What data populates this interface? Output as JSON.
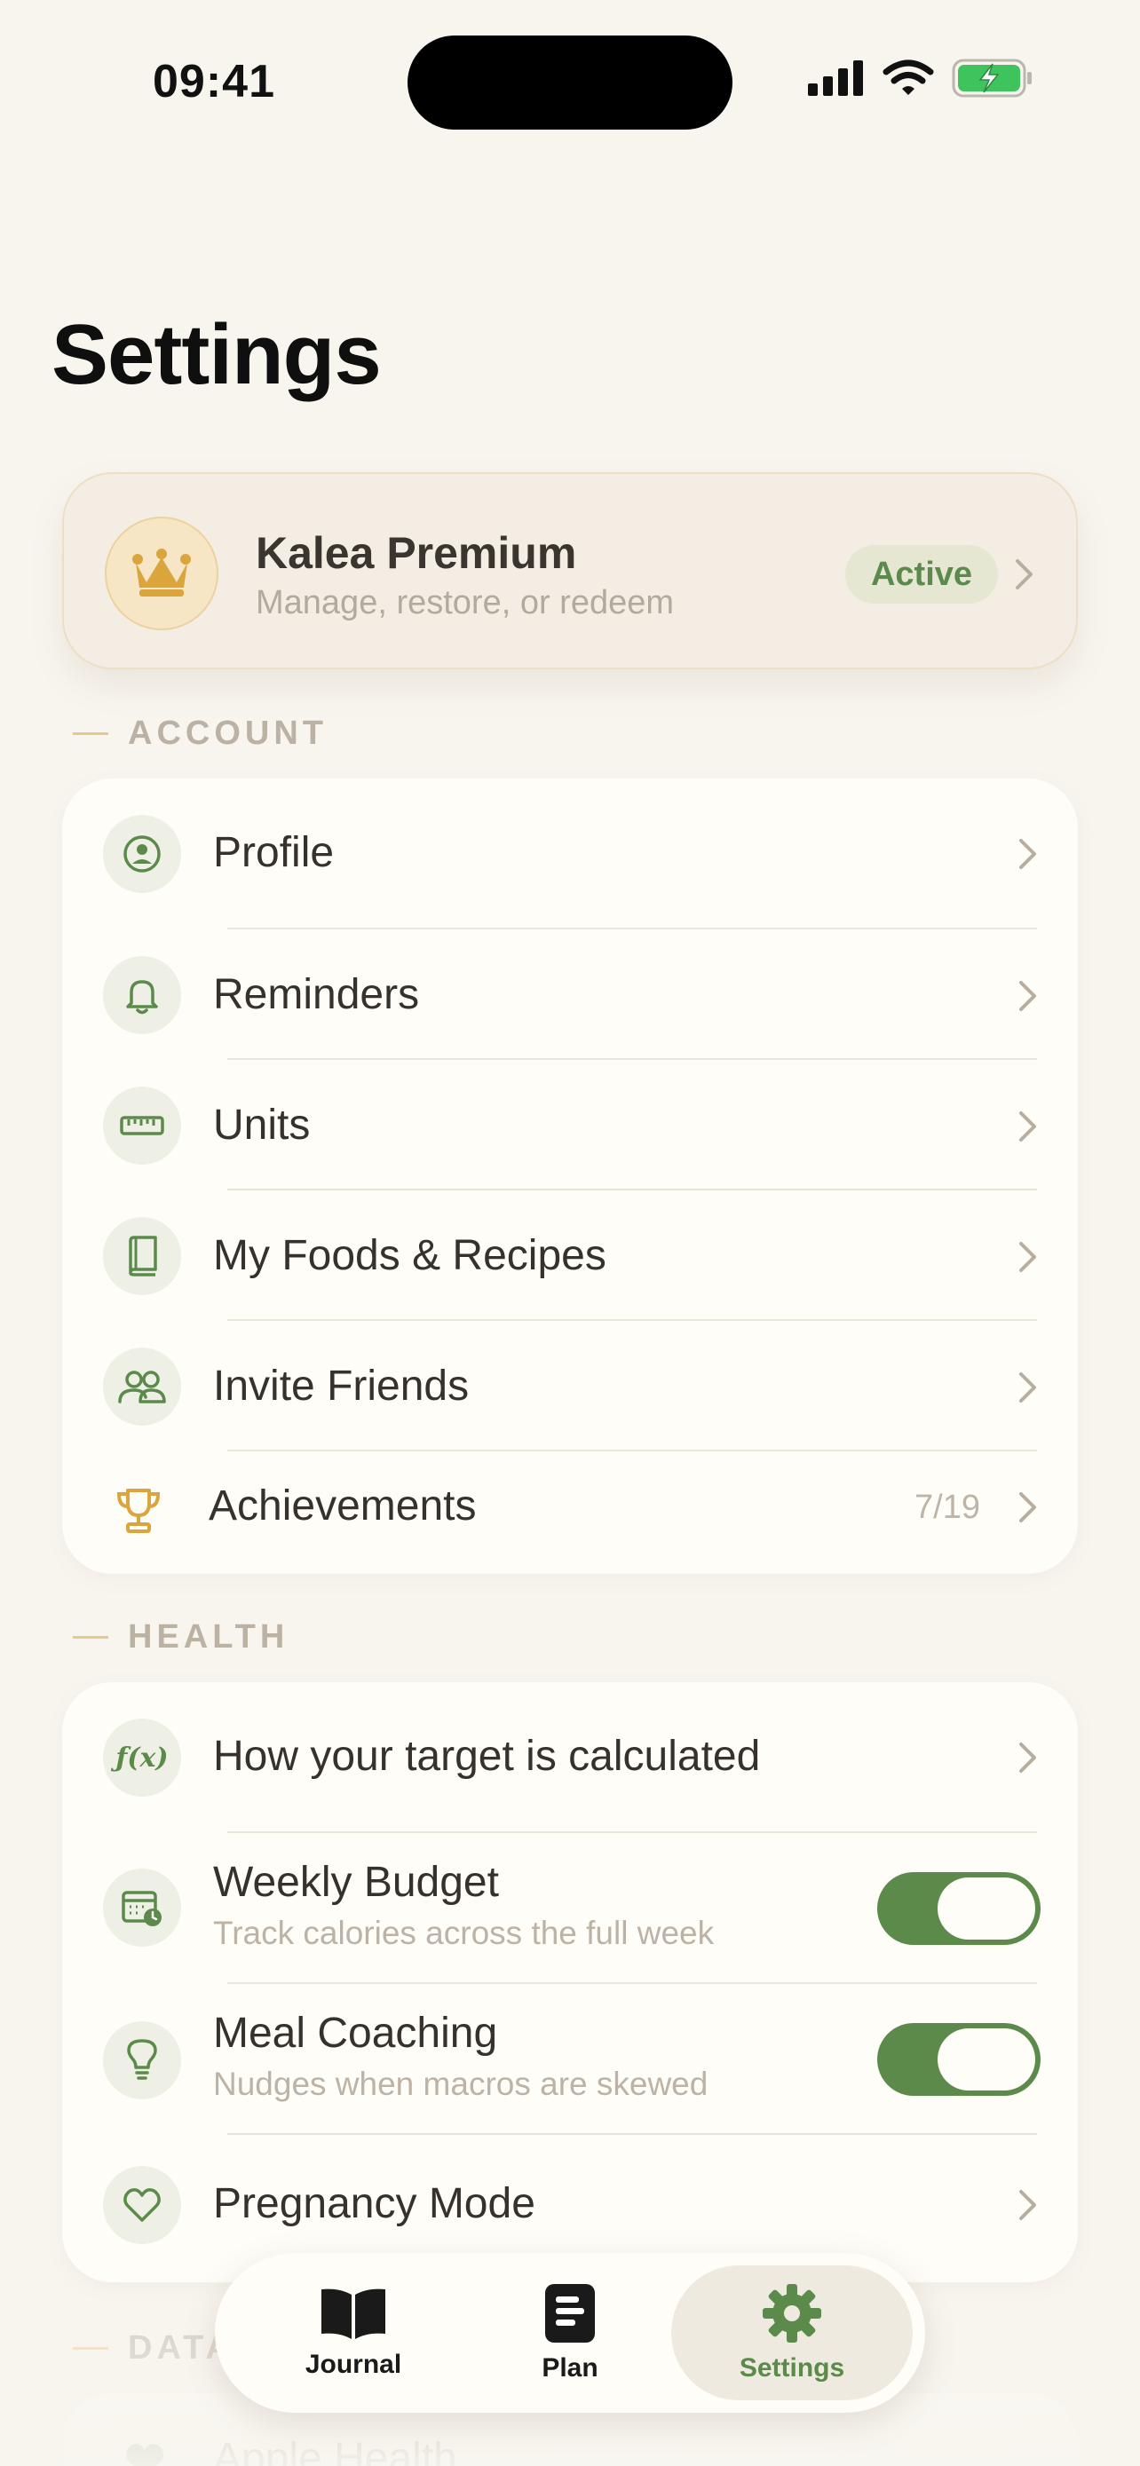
{
  "status": {
    "time": "09:41"
  },
  "page": {
    "title": "Settings"
  },
  "premium": {
    "title": "Kalea Premium",
    "subtitle": "Manage, restore, or redeem",
    "badge": "Active",
    "icon": "crown-icon"
  },
  "sections": {
    "account": {
      "label": "ACCOUNT",
      "items": [
        {
          "label": "Profile",
          "icon": "person-icon"
        },
        {
          "label": "Reminders",
          "icon": "bell-icon"
        },
        {
          "label": "Units",
          "icon": "ruler-icon"
        },
        {
          "label": "My Foods & Recipes",
          "icon": "book-icon"
        },
        {
          "label": "Invite Friends",
          "icon": "people-icon"
        },
        {
          "label": "Achievements",
          "icon": "trophy-icon",
          "value": "7/19"
        }
      ]
    },
    "health": {
      "label": "HEALTH",
      "items": [
        {
          "label": "How your target is calculated",
          "icon": "function-icon",
          "icon_text": "ƒ(x)"
        },
        {
          "label": "Weekly Budget",
          "subtitle": "Track calories across the full week",
          "icon": "calendar-clock-icon",
          "toggle": true
        },
        {
          "label": "Meal Coaching",
          "subtitle": "Nudges when macros are skewed",
          "icon": "lightbulb-icon",
          "toggle": true
        },
        {
          "label": "Pregnancy Mode",
          "icon": "heart-icon"
        }
      ]
    },
    "data": {
      "label": "DATA",
      "items": [
        {
          "label": "Apple Health",
          "icon": "heart-icon"
        }
      ]
    }
  },
  "tabbar": {
    "tabs": [
      {
        "label": "Journal",
        "icon": "open-book-icon"
      },
      {
        "label": "Plan",
        "icon": "clipboard-icon"
      },
      {
        "label": "Settings",
        "icon": "gear-icon",
        "active": true
      }
    ]
  },
  "colors": {
    "accent_green": "#5b8a4b",
    "gold": "#d9a53c",
    "background": "#f8f5ef",
    "card": "#fffdf8"
  }
}
